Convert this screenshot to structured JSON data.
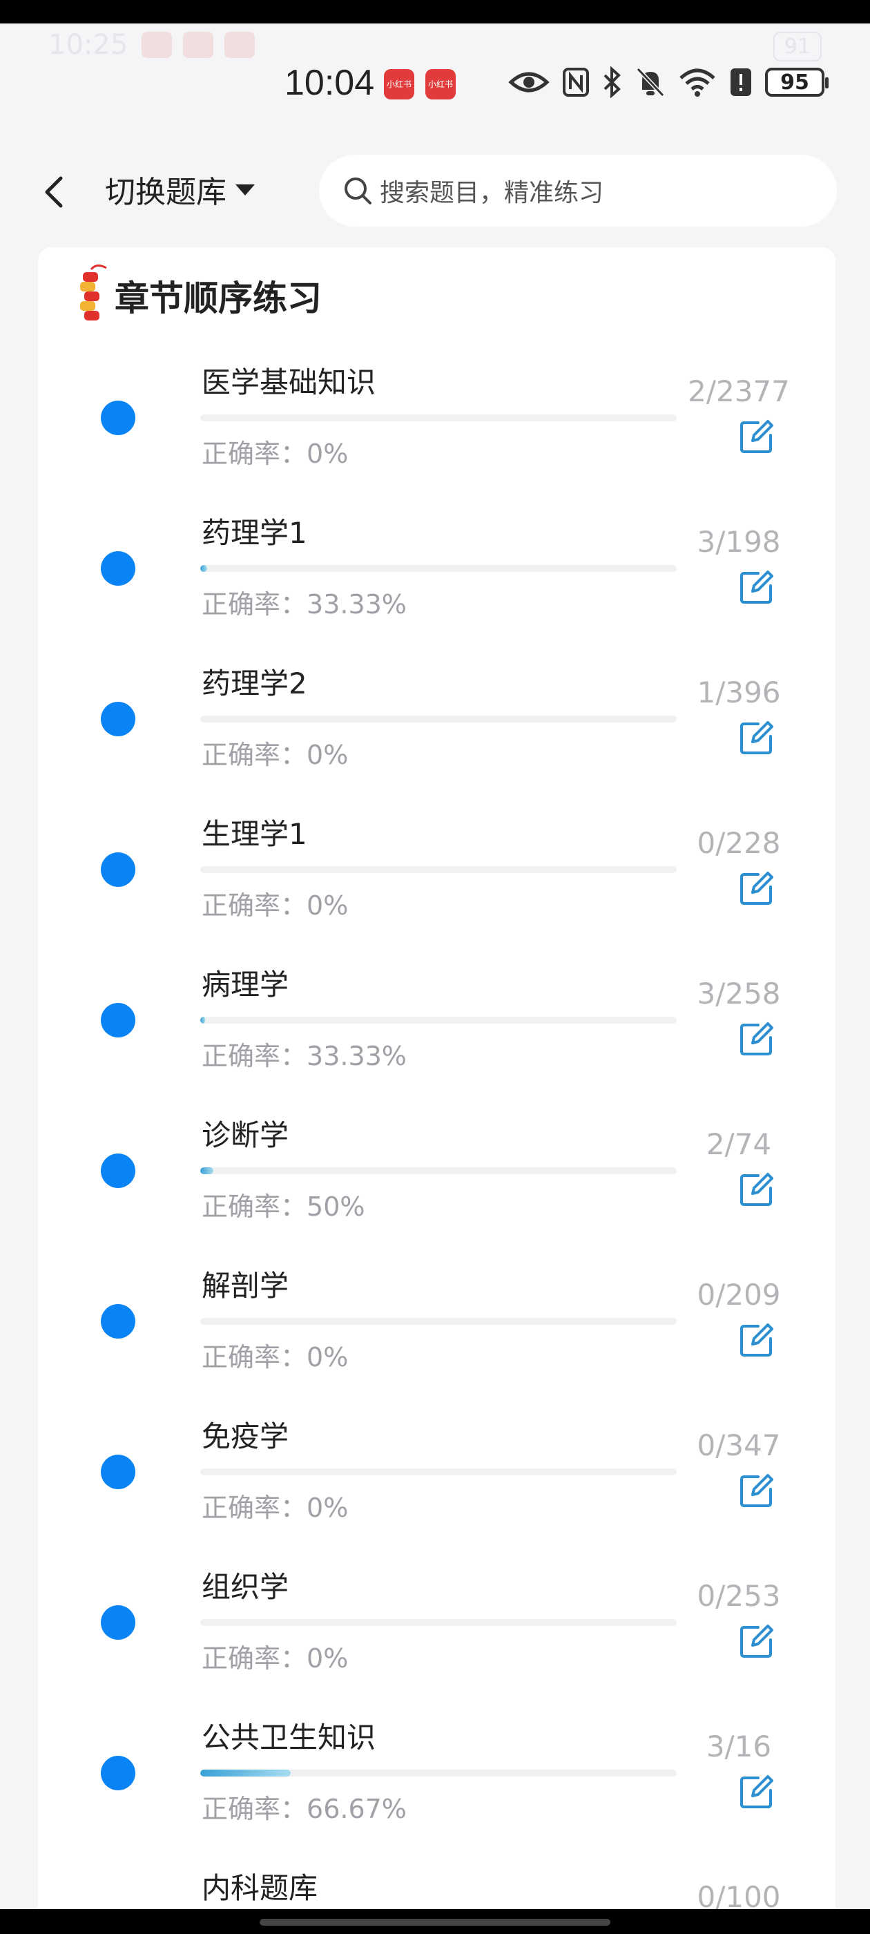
{
  "status": {
    "time": "10:04",
    "battery": "95",
    "ghost_time": "10:25",
    "ghost_battery": "91",
    "app_badge_label": "小红书"
  },
  "nav": {
    "switch_label": "切换题库",
    "search_placeholder": "搜索题目，精准练习"
  },
  "section": {
    "title": "章节顺序练习"
  },
  "accuracy_prefix": "正确率：",
  "chapters": [
    {
      "name": "医学基础知识",
      "accuracy": "0%",
      "count": "2/2377",
      "progress": 0.0
    },
    {
      "name": "药理学1",
      "accuracy": "33.33%",
      "count": "3/198",
      "progress": 0.015
    },
    {
      "name": "药理学2",
      "accuracy": "0%",
      "count": "1/396",
      "progress": 0.0
    },
    {
      "name": "生理学1",
      "accuracy": "0%",
      "count": "0/228",
      "progress": 0.0
    },
    {
      "name": "病理学",
      "accuracy": "33.33%",
      "count": "3/258",
      "progress": 0.01
    },
    {
      "name": "诊断学",
      "accuracy": "50%",
      "count": "2/74",
      "progress": 0.027
    },
    {
      "name": "解剖学",
      "accuracy": "0%",
      "count": "0/209",
      "progress": 0.0
    },
    {
      "name": "免疫学",
      "accuracy": "0%",
      "count": "0/347",
      "progress": 0.0
    },
    {
      "name": "组织学",
      "accuracy": "0%",
      "count": "0/253",
      "progress": 0.0
    },
    {
      "name": "公共卫生知识",
      "accuracy": "66.67%",
      "count": "3/16",
      "progress": 0.19
    },
    {
      "name": "内科题库",
      "accuracy": "",
      "count": "0/100",
      "progress": 0.0
    }
  ],
  "colors": {
    "accent_blue": "#0a84f5",
    "progress_fill": "#3aa0d6",
    "edit_icon": "#2b8fd0"
  },
  "icons": [
    "back-arrow-icon",
    "caret-down-icon",
    "search-icon",
    "firecracker-icon",
    "edit-icon",
    "eye-icon",
    "nfc-icon",
    "bluetooth-icon",
    "bell-off-icon",
    "wifi-icon",
    "battery-icon"
  ]
}
